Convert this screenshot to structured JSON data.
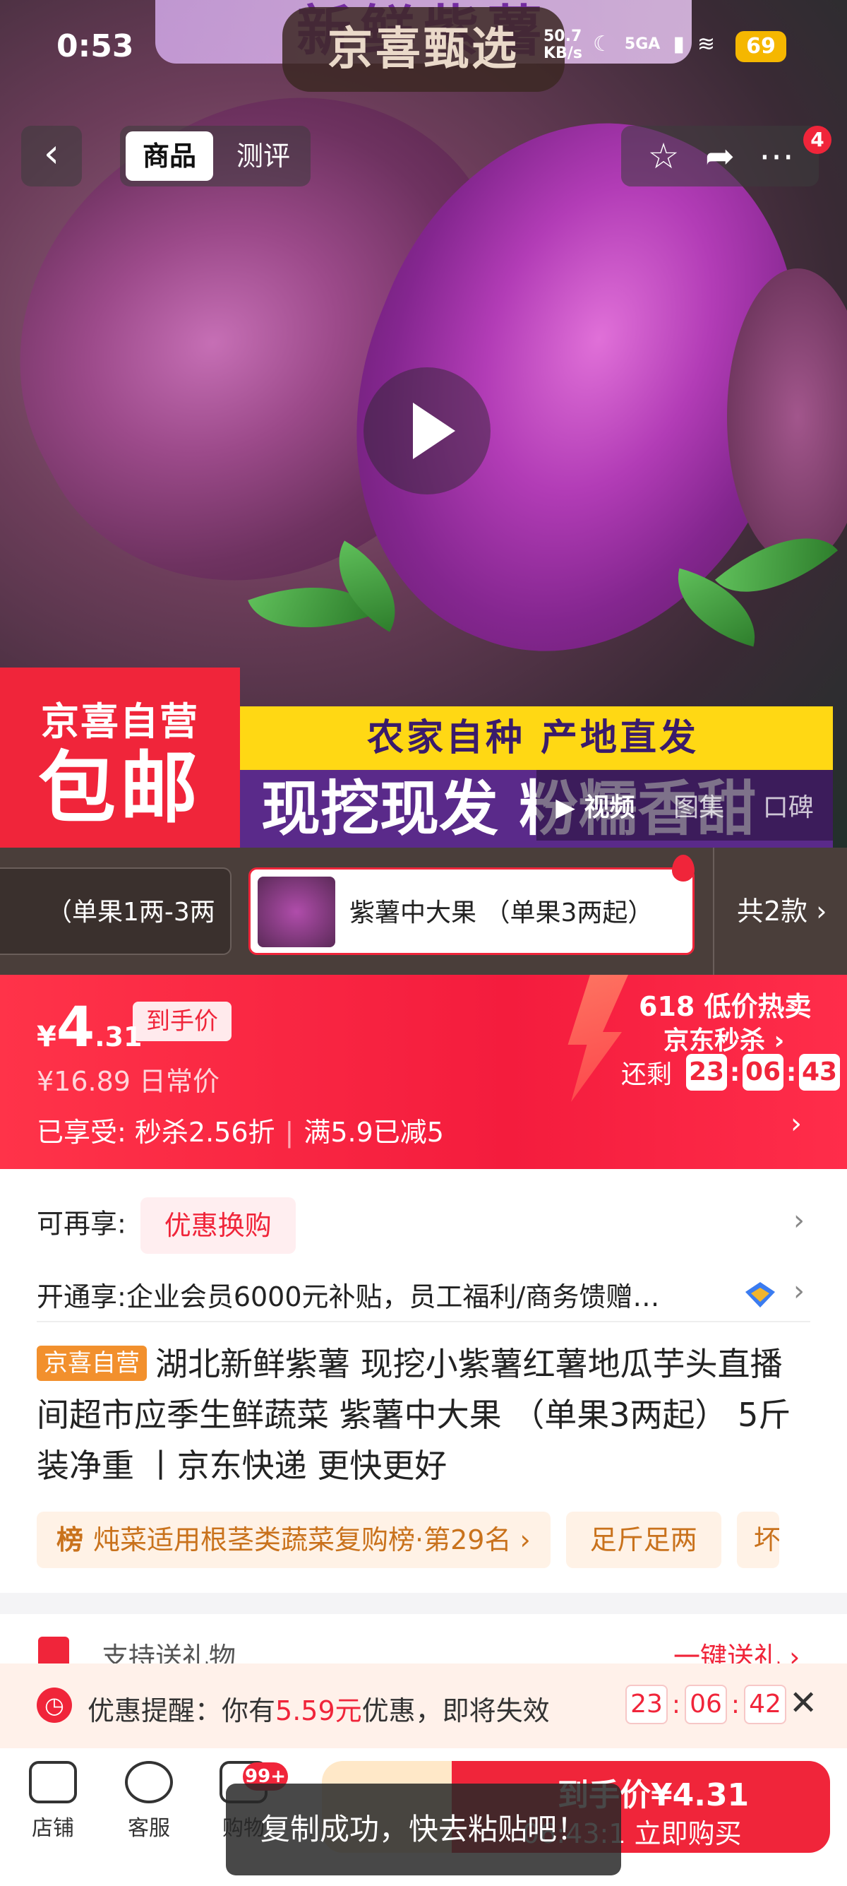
{
  "status_bar": {
    "time": "0:53",
    "net_speed_1": "50.7",
    "net_speed_2": "KB/s",
    "network": "5GA",
    "battery": "69"
  },
  "app_title": "京喜甄选",
  "hero": {
    "banner_top": "新鲜紫薯",
    "tabs": [
      "商品",
      "测评"
    ],
    "notif_count": "4",
    "promo_line1": "京喜自营",
    "promo_line2": "包邮",
    "slogan_line1": "农家自种 产地直发",
    "slogan_line2": "现挖现发 粉糯香甜",
    "media_tabs": [
      "▶ 视频",
      "图集",
      "口碑"
    ]
  },
  "variants": {
    "items": [
      "（单果1两-3两",
      "紫薯中大果 （单果3两起）"
    ],
    "count": "共2款 ›"
  },
  "price": {
    "currency": "¥",
    "integer": "4",
    "decimal": ".31",
    "tag": "到手价",
    "original": "¥16.89 日常价",
    "discount_label": "已享受:",
    "discount_1": "秒杀2.56折",
    "discount_2": "满5.9已减5",
    "sale_title": "618 低价热卖",
    "sale_sub": "京东秒杀 ›",
    "countdown_label": "还剩",
    "countdown": [
      "23",
      "06",
      "43"
    ]
  },
  "info": {
    "extra_label": "可再享:",
    "extra_chip": "优惠换购",
    "member_label": "开通享:",
    "member_text": "企业会员6000元补贴，员工福利/商务馈赠…",
    "tag": "京喜自营",
    "title": "湖北新鲜紫薯 现挖小紫薯红薯地瓜芋头直播 间超市应季生鲜蔬菜 紫薯中大果 （单果3两起） 5斤装净重 丨京东快递 更快更好",
    "rank_prefix": "榜",
    "rank_text": "炖菜适用根茎类蔬菜复购榜·第29名 ›",
    "qty_chip": "足斤足两",
    "qty_chip_cut": "坏"
  },
  "gift": {
    "label": "支持送礼物",
    "action": "一键送礼 ›"
  },
  "alert": {
    "prefix": "优惠提醒：你有",
    "amount": "5.59元",
    "suffix": "优惠，即将失效",
    "countdown": [
      "23",
      "06",
      "42"
    ]
  },
  "bottom": {
    "shop": "店铺",
    "service": "客服",
    "cart": "购物",
    "cart_badge": "99+",
    "buy_price": "到手价¥4.31",
    "buy_action": "06:43:1 立即购买"
  },
  "toast": "复制成功，快去粘贴吧！"
}
